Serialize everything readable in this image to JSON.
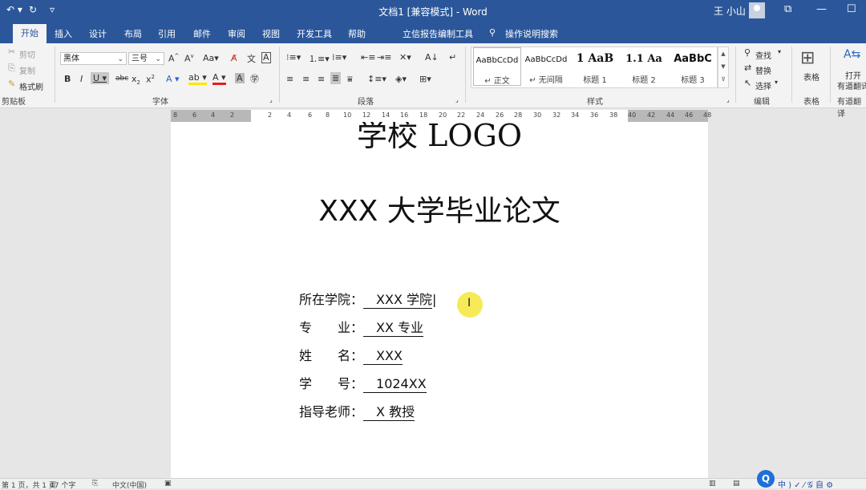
{
  "titlebar": {
    "title": "文档1 [兼容模式]  -  Word",
    "user": "王 小山",
    "qat_undo": "↶ ▾",
    "qat_redo": "↻",
    "qat_more": "▿",
    "restore": "⧉",
    "minimize": "—",
    "maximize": "☐"
  },
  "tabs": [
    "开始",
    "插入",
    "设计",
    "布局",
    "引用",
    "邮件",
    "审阅",
    "视图",
    "开发工具",
    "帮助",
    "立信报告编制工具",
    "操作说明搜索"
  ],
  "ribbon": {
    "clipboard": {
      "cut": "剪切",
      "copy": "复制",
      "painter": "格式刷",
      "label": "剪贴板"
    },
    "font": {
      "face": "黑体",
      "size": "三号",
      "label": "字体"
    },
    "paragraph": {
      "label": "段落"
    },
    "styles": {
      "label": "样式",
      "items": [
        {
          "sample": "AaBbCcDd",
          "name": "↵ 正文"
        },
        {
          "sample": "AaBbCcDd",
          "name": "↵ 无间隔"
        },
        {
          "sample": "1  AaB",
          "name": "标题 1"
        },
        {
          "sample": "1.1  Aa",
          "name": "标题 2"
        },
        {
          "sample": "AaBbC",
          "name": "标题 3"
        }
      ]
    },
    "editing": {
      "find": "查找",
      "replace": "替换",
      "select": "选择",
      "label": "编辑"
    },
    "table": {
      "name": "表格",
      "label": "表格"
    },
    "youdao": {
      "open": "打开",
      "name": "有道翻译",
      "label": "有道翻译"
    }
  },
  "ruler": [
    "8",
    "6",
    "4",
    "2",
    "",
    "2",
    "4",
    "6",
    "8",
    "10",
    "12",
    "14",
    "16",
    "18",
    "20",
    "22",
    "24",
    "26",
    "28",
    "30",
    "32",
    "34",
    "36",
    "38",
    "40",
    "42",
    "44",
    "46",
    "48"
  ],
  "document": {
    "logo": "学校 LOGO",
    "thesis_title": "XXX 大学毕业论文",
    "fields": [
      {
        "label": "所在学院：",
        "value": "XXX 学院"
      },
      {
        "label": "专　　业：",
        "value": "XX 专业"
      },
      {
        "label": "姓　　名：",
        "value": "XXX"
      },
      {
        "label": "学　　号：",
        "value": "1024XX"
      },
      {
        "label": "指导老师：",
        "value": "X 教授"
      }
    ]
  },
  "status": {
    "page": "第 1 页，共 1 页",
    "words": "47 个字",
    "lang": "中文(中国)",
    "tray": "中 ) ✓ ⁄ 𝒢 自 ⚙"
  }
}
